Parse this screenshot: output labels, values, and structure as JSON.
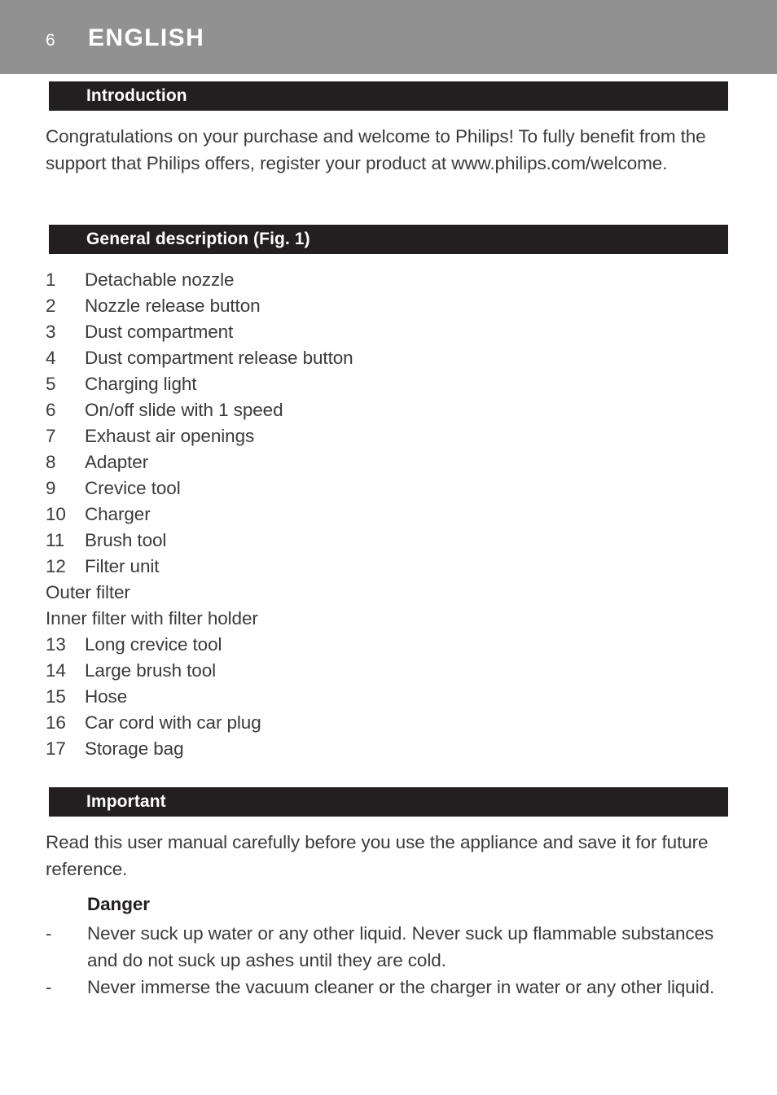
{
  "page": {
    "number": "6",
    "language": "ENGLISH",
    "band_color": "#919191",
    "bar_color": "#231f20",
    "text_color": "#3b3b3b"
  },
  "sections": {
    "introduction": {
      "heading": "Introduction",
      "body": "Congratulations on your purchase and welcome to Philips! To fully benefit from the support that Philips offers, register your product at www.philips.com/welcome."
    },
    "general_description": {
      "heading": "General description (Fig. 1)",
      "items": [
        {
          "num": "1",
          "label": "Detachable nozzle"
        },
        {
          "num": "2",
          "label": "Nozzle release button"
        },
        {
          "num": "3",
          "label": "Dust compartment"
        },
        {
          "num": "4",
          "label": "Dust compartment release button"
        },
        {
          "num": "5",
          "label": "Charging light"
        },
        {
          "num": "6",
          "label": "On/off slide with 1 speed"
        },
        {
          "num": "7",
          "label": "Exhaust air openings"
        },
        {
          "num": "8",
          "label": "Adapter"
        },
        {
          "num": "9",
          "label": "Crevice tool"
        },
        {
          "num": "10",
          "label": "Charger"
        },
        {
          "num": "11",
          "label": "Brush tool"
        },
        {
          "num": "12",
          "label": "Filter unit"
        },
        {
          "num": "",
          "label": "Outer filter"
        },
        {
          "num": "",
          "label": "Inner filter with filter holder"
        },
        {
          "num": "13",
          "label": "Long crevice tool"
        },
        {
          "num": "14",
          "label": "Large brush tool"
        },
        {
          "num": "15",
          "label": "Hose"
        },
        {
          "num": "16",
          "label": "Car cord with car plug"
        },
        {
          "num": "17",
          "label": "Storage bag"
        }
      ]
    },
    "important": {
      "heading": "Important",
      "body": "Read this user manual carefully before you use the appliance and save it for future reference.",
      "danger": {
        "heading": "Danger",
        "bullets": [
          {
            "marker": "-",
            "text": "Never suck up water or any other liquid. Never suck up flammable substances and do not suck up ashes until they are cold."
          },
          {
            "marker": "-",
            "text": "Never immerse the vacuum cleaner or the charger in water or any other liquid."
          }
        ]
      }
    }
  }
}
